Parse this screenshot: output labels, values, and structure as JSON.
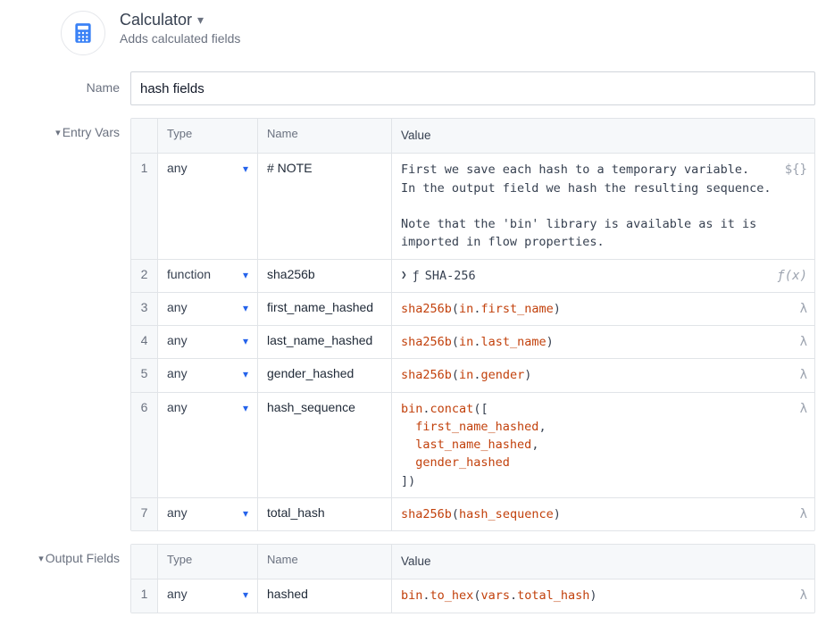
{
  "header": {
    "title": "Calculator",
    "subtitle": "Adds calculated fields"
  },
  "labels": {
    "name": "Name",
    "entry_vars": "Entry Vars",
    "output_fields": "Output Fields"
  },
  "name_value": "hash fields",
  "columns": {
    "type": "Type",
    "name": "Name",
    "value": "Value"
  },
  "entry_vars": [
    {
      "idx": "1",
      "type": "any",
      "name": "# NOTE",
      "value_kind": "text",
      "value": "First we save each hash to a temporary variable.\nIn the output field we hash the resulting sequence.\n\nNote that the 'bin' library is available as it is\nimported in flow properties.",
      "action_icon": "template-icon"
    },
    {
      "idx": "2",
      "type": "function",
      "name": "sha256b",
      "value_kind": "function_ref",
      "fn_label": "SHA-256",
      "action_icon": "fx-icon"
    },
    {
      "idx": "3",
      "type": "any",
      "name": "first_name_hashed",
      "value_kind": "code",
      "tokens": [
        {
          "t": "fn",
          "v": "sha256b"
        },
        {
          "t": "plain",
          "v": "("
        },
        {
          "t": "obj",
          "v": "in"
        },
        {
          "t": "plain",
          "v": "."
        },
        {
          "t": "obj",
          "v": "first_name"
        },
        {
          "t": "plain",
          "v": ")"
        }
      ],
      "action_icon": "lambda-icon"
    },
    {
      "idx": "4",
      "type": "any",
      "name": "last_name_hashed",
      "value_kind": "code",
      "tokens": [
        {
          "t": "fn",
          "v": "sha256b"
        },
        {
          "t": "plain",
          "v": "("
        },
        {
          "t": "obj",
          "v": "in"
        },
        {
          "t": "plain",
          "v": "."
        },
        {
          "t": "obj",
          "v": "last_name"
        },
        {
          "t": "plain",
          "v": ")"
        }
      ],
      "action_icon": "lambda-icon"
    },
    {
      "idx": "5",
      "type": "any",
      "name": "gender_hashed",
      "value_kind": "code",
      "tokens": [
        {
          "t": "fn",
          "v": "sha256b"
        },
        {
          "t": "plain",
          "v": "("
        },
        {
          "t": "obj",
          "v": "in"
        },
        {
          "t": "plain",
          "v": "."
        },
        {
          "t": "obj",
          "v": "gender"
        },
        {
          "t": "plain",
          "v": ")"
        }
      ],
      "action_icon": "lambda-icon"
    },
    {
      "idx": "6",
      "type": "any",
      "name": "hash_sequence",
      "value_kind": "code",
      "tokens": [
        {
          "t": "obj",
          "v": "bin"
        },
        {
          "t": "plain",
          "v": "."
        },
        {
          "t": "fn",
          "v": "concat"
        },
        {
          "t": "plain",
          "v": "([\n  "
        },
        {
          "t": "obj",
          "v": "first_name_hashed"
        },
        {
          "t": "plain",
          "v": ",\n  "
        },
        {
          "t": "obj",
          "v": "last_name_hashed"
        },
        {
          "t": "plain",
          "v": ",\n  "
        },
        {
          "t": "obj",
          "v": "gender_hashed"
        },
        {
          "t": "plain",
          "v": "\n])"
        }
      ],
      "action_icon": "lambda-icon"
    },
    {
      "idx": "7",
      "type": "any",
      "name": "total_hash",
      "value_kind": "code",
      "tokens": [
        {
          "t": "fn",
          "v": "sha256b"
        },
        {
          "t": "plain",
          "v": "("
        },
        {
          "t": "obj",
          "v": "hash_sequence"
        },
        {
          "t": "plain",
          "v": ")"
        }
      ],
      "action_icon": "lambda-icon"
    }
  ],
  "output_fields": [
    {
      "idx": "1",
      "type": "any",
      "name": "hashed",
      "value_kind": "code",
      "tokens": [
        {
          "t": "obj",
          "v": "bin"
        },
        {
          "t": "plain",
          "v": "."
        },
        {
          "t": "fn",
          "v": "to_hex"
        },
        {
          "t": "plain",
          "v": "("
        },
        {
          "t": "obj",
          "v": "vars"
        },
        {
          "t": "plain",
          "v": "."
        },
        {
          "t": "obj",
          "v": "total_hash"
        },
        {
          "t": "plain",
          "v": ")"
        }
      ],
      "action_icon": "lambda-icon"
    }
  ],
  "icons": {
    "lambda": "λ",
    "fx": "ƒ(x)",
    "template": "${}",
    "fn_glyph": "ƒ"
  }
}
